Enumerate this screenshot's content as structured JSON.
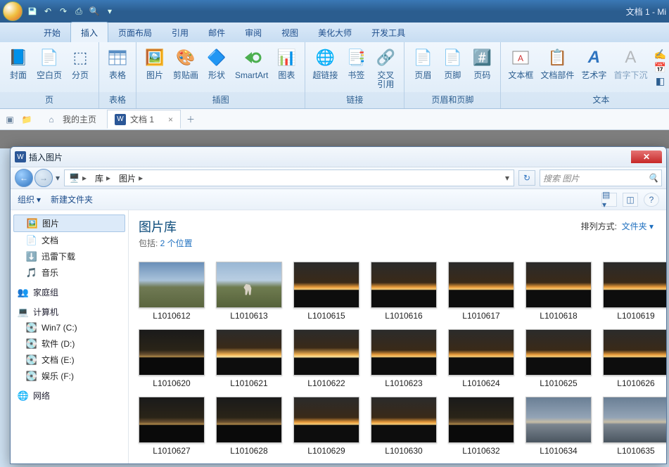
{
  "app_title": "文档 1 - Mi",
  "tabs": {
    "t0": "开始",
    "t1": "插入",
    "t2": "页面布局",
    "t3": "引用",
    "t4": "邮件",
    "t5": "审阅",
    "t6": "视图",
    "t7": "美化大师",
    "t8": "开发工具"
  },
  "ribbon": {
    "pages": {
      "group": "页",
      "cover": "封面",
      "blank": "空白页",
      "break": "分页"
    },
    "table": {
      "group": "表格",
      "table": "表格"
    },
    "illus": {
      "group": "插图",
      "pic": "图片",
      "clip": "剪贴画",
      "shapes": "形状",
      "smartart": "SmartArt",
      "chart": "图表"
    },
    "links": {
      "group": "链接",
      "hyper": "超链接",
      "bookmark": "书签",
      "xref": "交叉\n引用"
    },
    "hf": {
      "group": "页眉和页脚",
      "header": "页眉",
      "footer": "页脚",
      "pageno": "页码"
    },
    "text": {
      "group": "文本",
      "textbox": "文本框",
      "parts": "文档部件",
      "wordart": "艺术字",
      "dropcap": "首字下沉",
      "sig": "签名行",
      "datetime": "日期和",
      "obj": "对象"
    }
  },
  "doctabs": {
    "home": "我的主页",
    "doc": "文档 1"
  },
  "dialog": {
    "title": "插入图片",
    "crumbs": {
      "c0": "库",
      "c1": "图片"
    },
    "search_placeholder": "搜索 图片",
    "organize": "组织",
    "newfolder": "新建文件夹",
    "header": "图片库",
    "sub_prefix": "包括: ",
    "sub_link": "2 个位置",
    "sort_label": "排列方式:",
    "sort_value": "文件夹",
    "tree": {
      "pictures": "图片",
      "docs": "文档",
      "xl": "迅雷下载",
      "music": "音乐",
      "homegroup": "家庭组",
      "computer": "计算机",
      "c": "Win7 (C:)",
      "d": "软件 (D:)",
      "e": "文档 (E:)",
      "f": "娱乐 (F:)",
      "network": "网络"
    },
    "thumbs": [
      {
        "name": "L1010612",
        "cls": "sky1"
      },
      {
        "name": "L1010613",
        "cls": "horse"
      },
      {
        "name": "L1010615",
        "cls": "sunset"
      },
      {
        "name": "L1010616",
        "cls": "sunset"
      },
      {
        "name": "L1010617",
        "cls": "sunset"
      },
      {
        "name": "L1010618",
        "cls": "sunset"
      },
      {
        "name": "L1010619",
        "cls": "sunset"
      },
      {
        "name": "L1010620",
        "cls": "dimsun"
      },
      {
        "name": "L1010621",
        "cls": "bright"
      },
      {
        "name": "L1010622",
        "cls": "bright"
      },
      {
        "name": "L1010623",
        "cls": "sunset"
      },
      {
        "name": "L1010624",
        "cls": "sunset"
      },
      {
        "name": "L1010625",
        "cls": "sunset"
      },
      {
        "name": "L1010626",
        "cls": "sunset"
      },
      {
        "name": "L1010627",
        "cls": "dimsun"
      },
      {
        "name": "L1010628",
        "cls": "dimsun"
      },
      {
        "name": "L1010629",
        "cls": "sunset"
      },
      {
        "name": "L1010630",
        "cls": "sunset"
      },
      {
        "name": "L1010632",
        "cls": "dimsun"
      },
      {
        "name": "L1010634",
        "cls": "lake"
      },
      {
        "name": "L1010635",
        "cls": "lake"
      }
    ]
  }
}
